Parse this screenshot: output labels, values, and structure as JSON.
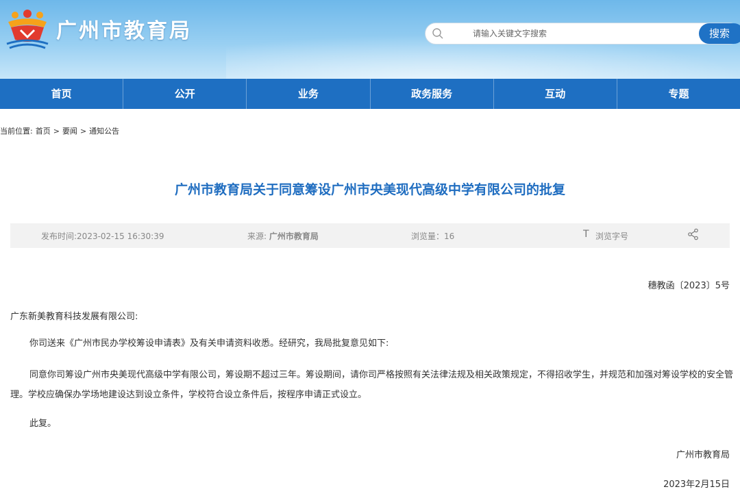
{
  "header": {
    "site_title": "广州市教育局",
    "search_placeholder": "请输入关键文字搜索",
    "search_button": "搜索"
  },
  "nav": {
    "items": [
      {
        "label": "首页"
      },
      {
        "label": "公开"
      },
      {
        "label": "业务"
      },
      {
        "label": "政务服务"
      },
      {
        "label": "互动"
      },
      {
        "label": "专题"
      }
    ]
  },
  "breadcrumb": {
    "prefix": "当前位置:",
    "items": [
      "首页",
      "要闻",
      "通知公告"
    ],
    "separator": ">"
  },
  "article": {
    "title": "广州市教育局关于同意筹设广州市央美现代高级中学有限公司的批复",
    "meta": {
      "publish_time": "发布时间:2023-02-15 16:30:39",
      "source_label": "来源:",
      "source_value": "广州市教育局",
      "views": "浏览量：16",
      "font_icon": "T",
      "font_label": "浏览字号"
    },
    "doc_number": "穗教函〔2023〕5号",
    "addressee": "广东新美教育科技发展有限公司:",
    "paragraphs": [
      "你司送来《广州市民办学校筹设申请表》及有关申请资料收悉。经研究，我局批复意见如下:",
      "同意你司筹设广州市央美现代高级中学有限公司，筹设期不超过三年。筹设期间，请你司严格按照有关法律法规及相关政策规定，不得招收学生，并规范和加强对筹设学校的安全管理。学校应确保办学场地建设达到设立条件，学校符合设立条件后，按程序申请正式设立。",
      "此复。"
    ],
    "signature": "广州市教育局",
    "date": "2023年2月15日"
  },
  "colors": {
    "nav_blue": "#1e6fc2",
    "title_blue": "#1f6dc0",
    "logo_red": "#e23b2e",
    "logo_orange": "#f6a21a"
  }
}
